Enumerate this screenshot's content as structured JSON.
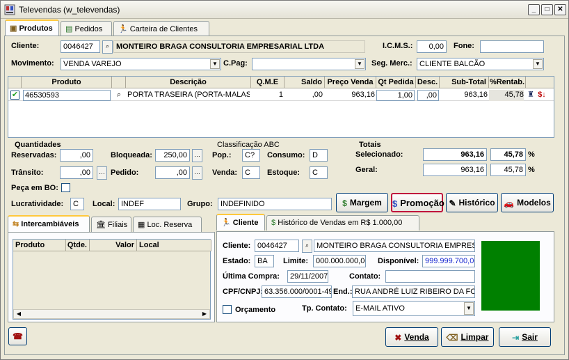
{
  "window": {
    "title": "Televendas (w_televendas)"
  },
  "tabs": [
    "Produtos",
    "Pedidos",
    "Carteira de Clientes"
  ],
  "header": {
    "cliente_label": "Cliente:",
    "cliente_code": "0046427",
    "cliente_name": "MONTEIRO BRAGA CONSULTORIA EMPRESARIAL LTDA",
    "icms_label": "I.C.M.S.:",
    "icms_value": "0,00",
    "fone_label": "Fone:",
    "fone_value": "",
    "movimento_label": "Movimento:",
    "movimento_value": "VENDA VAREJO",
    "cpag_label": "C.Pag:",
    "cpag_value": "",
    "segmerc_label": "Seg. Merc.:",
    "segmerc_value": "CLIENTE BALCÃO"
  },
  "grid": {
    "columns": [
      "Produto",
      "Descrição",
      "Q.M.E",
      "Saldo",
      "Preço Venda",
      "Qt Pedida",
      "Desc.",
      "Sub-Total",
      "%Rentab."
    ],
    "rows": [
      {
        "produto": "46530593",
        "descricao": "PORTA TRASEIRA (PORTA-MALAS)",
        "qme": "1",
        "saldo": ",00",
        "preco": "963,16",
        "qt": "1,00",
        "desc": ",00",
        "subtotal": "963,16",
        "rentab": "45,78"
      }
    ]
  },
  "quantidades": {
    "title": "Quantidades",
    "reservadas_label": "Reservadas:",
    "reservadas_value": ",00",
    "bloqueada_label": "Bloqueada:",
    "bloqueada_value": "250,00",
    "transito_label": "Trânsito:",
    "transito_value": ",00",
    "pedido_label": "Pedido:",
    "pedido_value": ",00",
    "pecabo_label": "Peça em BO:"
  },
  "abc": {
    "title": "Classificação ABC",
    "pop_label": "Pop.:",
    "pop_value": "C?",
    "consumo_label": "Consumo:",
    "consumo_value": "D",
    "venda_label": "Venda:",
    "venda_value": "C",
    "estoque_label": "Estoque:",
    "estoque_value": "C"
  },
  "totais": {
    "title": "Totais",
    "selecionado_label": "Selecionado:",
    "selecionado_value": "963,16",
    "selecionado_pct": "45,78",
    "geral_label": "Geral:",
    "geral_value": "963,16",
    "geral_pct": "45,78",
    "pct": "%"
  },
  "lucro": {
    "lucratividade_label": "Lucratividade:",
    "lucratividade_value": "C",
    "local_label": "Local:",
    "local_value": "INDEF",
    "grupo_label": "Grupo:",
    "grupo_value": "INDEFINIDO"
  },
  "action_buttons": {
    "margem": "Margem",
    "promocao": "Promoção",
    "historico": "Histórico",
    "modelos": "Modelos"
  },
  "left_tabs": [
    "Intercambiáveis",
    "Filiais",
    "Loc. Reserva"
  ],
  "left_grid": {
    "columns": [
      "Produto",
      "Qtde.",
      "Valor",
      "Local"
    ]
  },
  "right_tabs": [
    "Cliente",
    "Histórico de Vendas em R$ 1.000,00"
  ],
  "cliente_panel": {
    "cliente_label": "Cliente:",
    "cliente_code": "0046427",
    "cliente_name": "MONTEIRO BRAGA CONSULTORIA EMPRESARIAL LTDA",
    "estado_label": "Estado:",
    "estado_value": "BA",
    "limite_label": "Limite:",
    "limite_value": "000.000.000,00",
    "disponivel_label": "Disponível:",
    "disponivel_value": "999.999.700,00",
    "ultima_label": "Última Compra:",
    "ultima_value": "29/11/2007",
    "contato_label": "Contato:",
    "contato_value": "",
    "cpf_label": "CPF/CNPJ:",
    "cpf_value": "63.356.000/0001-49",
    "end_label": "End.:",
    "end_value": "RUA ANDRÉ LUIZ RIBEIRO DA FONTE",
    "orcamento_label": "Orçamento",
    "tpcontato_label": "Tp. Contato:",
    "tpcontato_value": "E-MAIL ATIVO",
    "status_color": "#008000"
  },
  "bottom_buttons": {
    "venda": "Venda",
    "limpar": "Limpar",
    "sair": "Sair"
  },
  "colors": {
    "accent": "#ffc83c",
    "field_border": "#7f9db9",
    "button_border": "#003c74",
    "promo_border": "#c0143c",
    "status_green": "#008000"
  }
}
